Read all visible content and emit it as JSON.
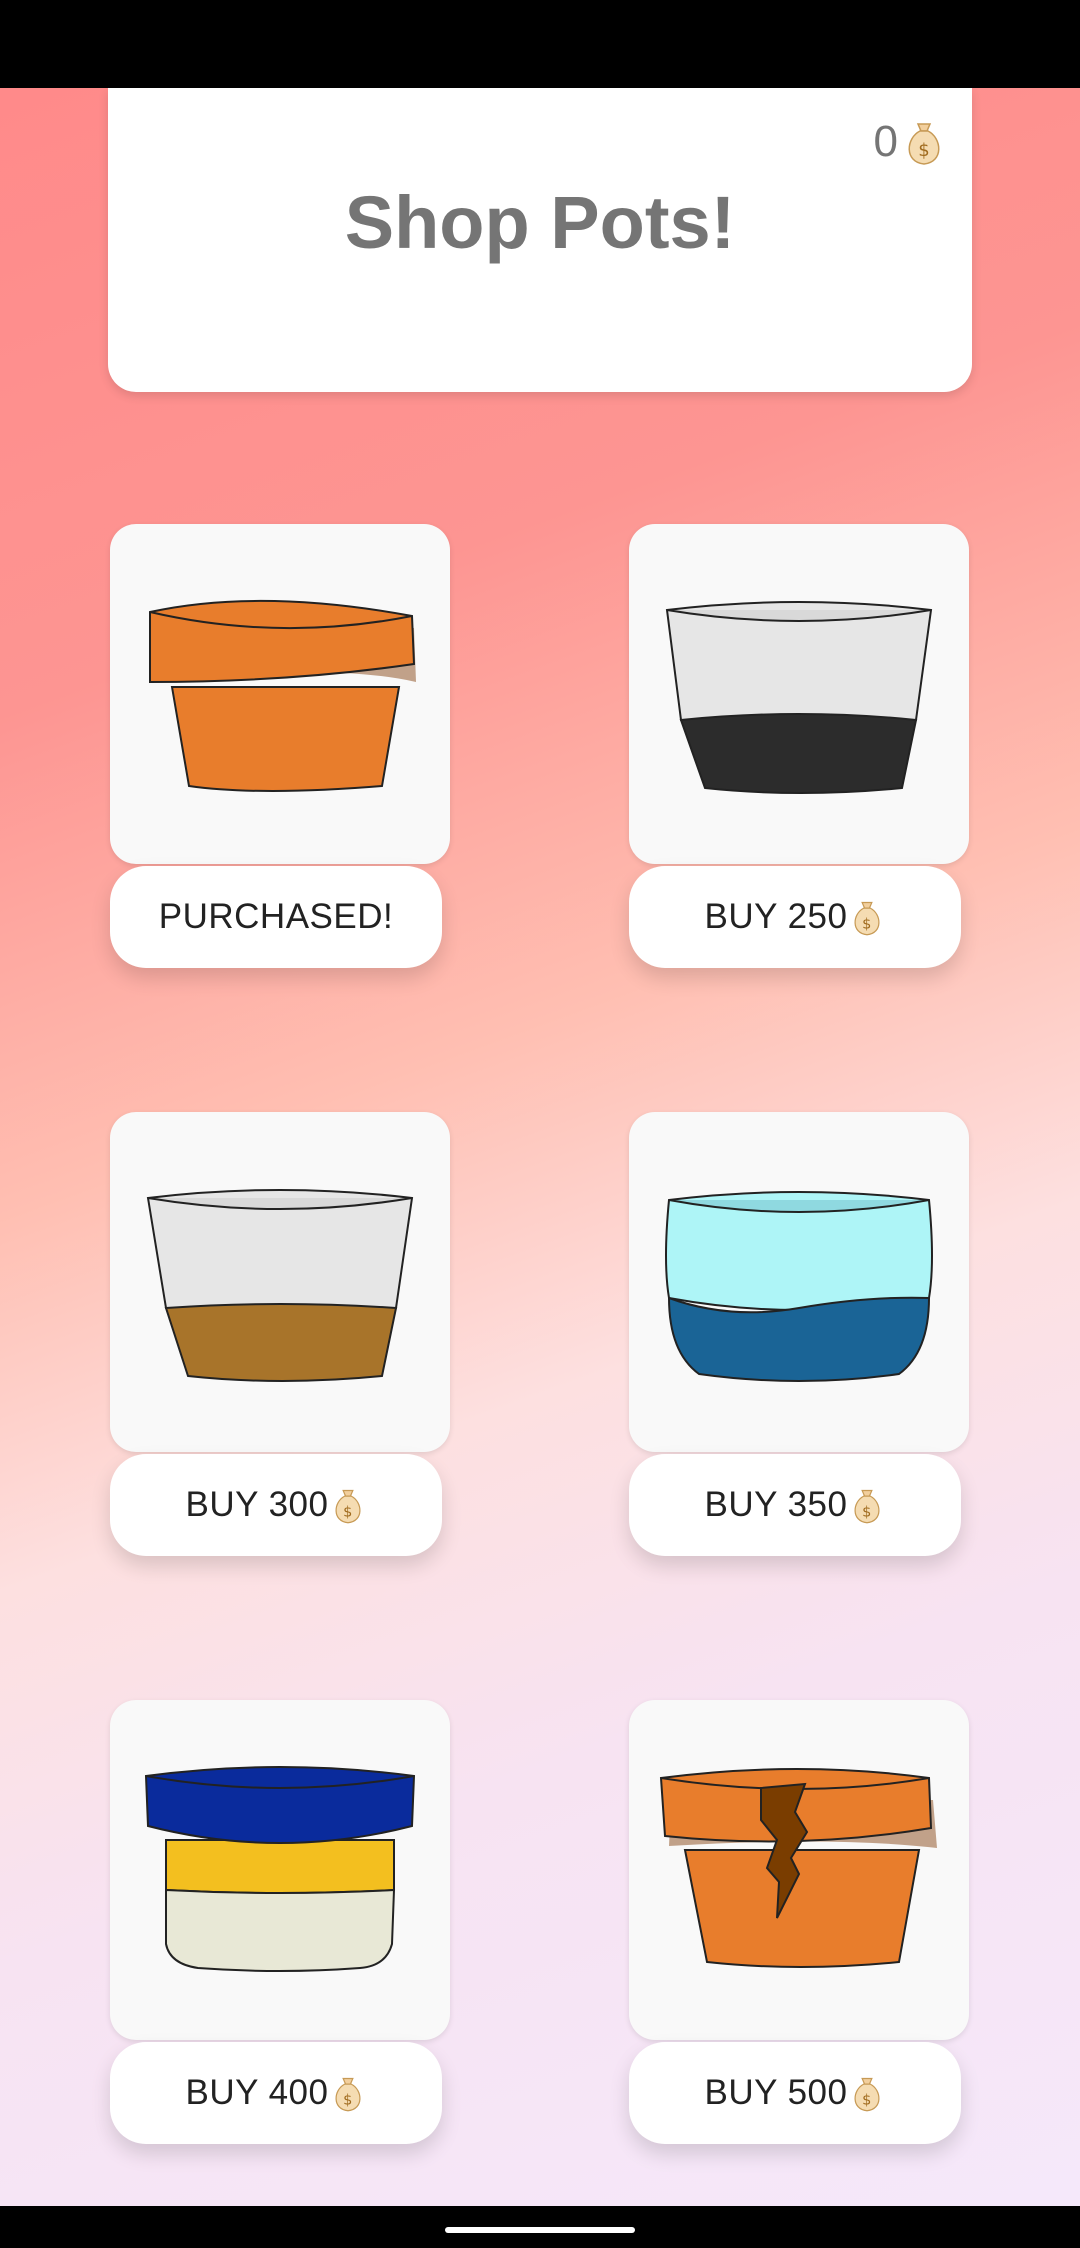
{
  "header": {
    "title": "Shop Pots!",
    "coins": "0",
    "coin_icon": "money-bag-icon"
  },
  "items": [
    {
      "pot": "orange-terracotta-pot",
      "button_label": "PURCHASED!",
      "show_coin": false
    },
    {
      "pot": "white-black-pot",
      "button_label": "BUY 250",
      "show_coin": true
    },
    {
      "pot": "white-brown-pot",
      "button_label": "BUY 300",
      "show_coin": true
    },
    {
      "pot": "cyan-blue-pot",
      "button_label": "BUY 350",
      "show_coin": true
    },
    {
      "pot": "blue-yellow-cream-pot",
      "button_label": "BUY 400",
      "show_coin": true
    },
    {
      "pot": "cracked-orange-pot",
      "button_label": "BUY 500",
      "show_coin": true
    }
  ],
  "colors": {
    "terracotta": "#e87d2c",
    "black_band": "#2c2c2c",
    "white_top": "#e6e6e6",
    "brown_band": "#a8742a",
    "cyan_top": "#aef5f7",
    "blue_band": "#1a6496",
    "navy_lid": "#0a2b9c",
    "yellow_band": "#f3bf1f",
    "cream_band": "#e8e8d6",
    "crack_brown": "#7a3d00"
  }
}
